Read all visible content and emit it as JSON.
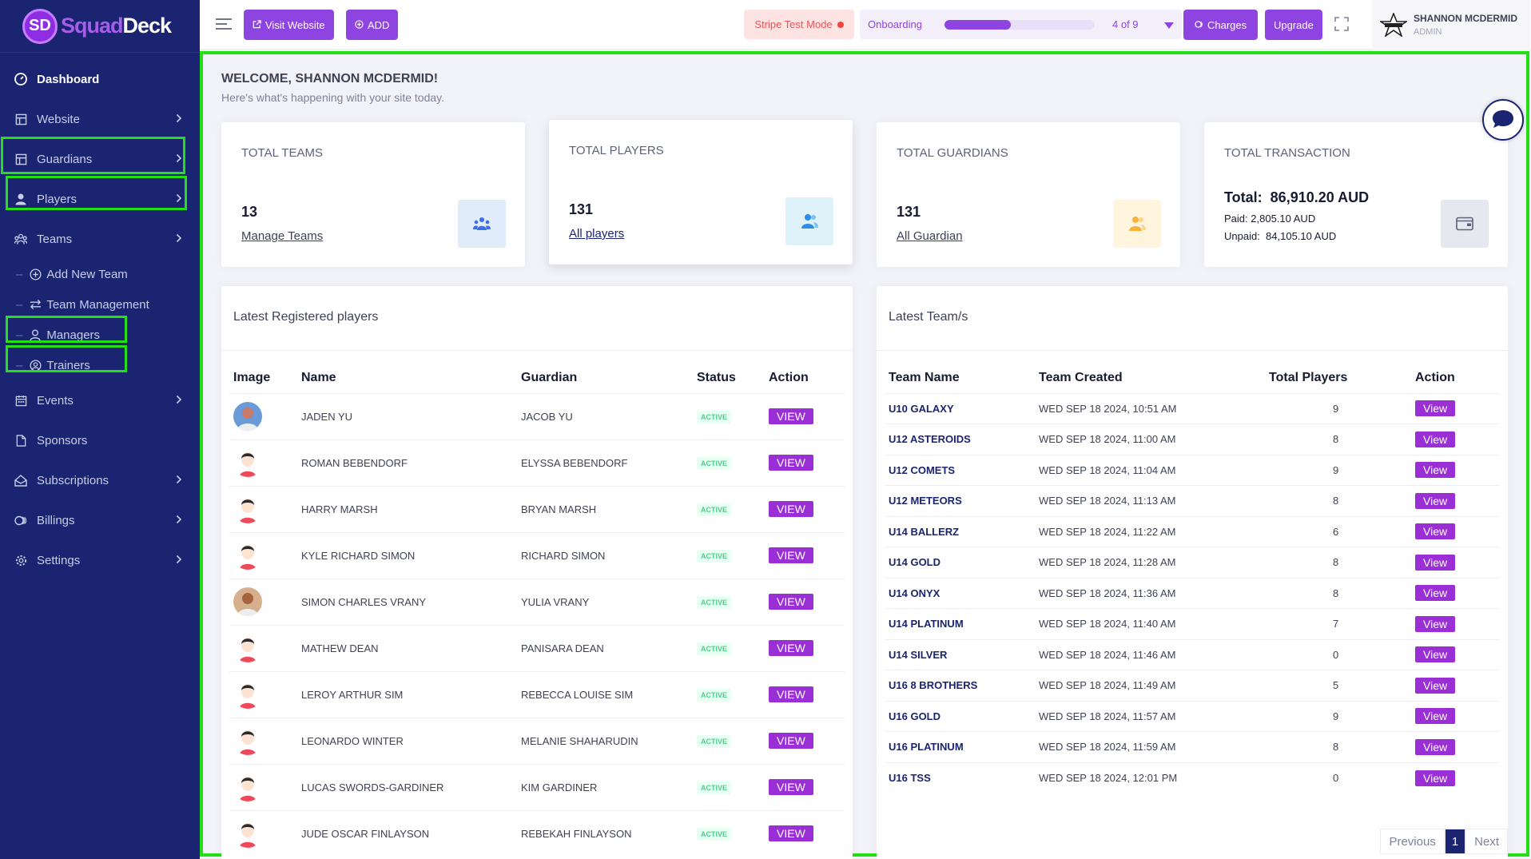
{
  "brand": {
    "logo_letters": "SD",
    "name_a": "Squad",
    "name_b": "Deck"
  },
  "sidebar": {
    "dashboard": "Dashboard",
    "website": "Website",
    "guardians": "Guardians",
    "players": "Players",
    "teams": "Teams",
    "add_new_team": "Add New Team",
    "team_management": "Team Management",
    "managers": "Managers",
    "trainers": "Trainers",
    "events": "Events",
    "sponsors": "Sponsors",
    "subscriptions": "Subscriptions",
    "billings": "Billings",
    "settings": "Settings"
  },
  "topbar": {
    "visit_website": "Visit Website",
    "add": "ADD",
    "stripe_mode": "Stripe Test Mode",
    "onboarding_label": "Onboarding",
    "onboarding_count": "4 of 9",
    "onboarding_progress": 0.44,
    "charges": "Charges",
    "upgrade": "Upgrade",
    "user_name": "SHANNON MCDERMID",
    "user_role": "ADMIN"
  },
  "welcome": {
    "title": "WELCOME, SHANNON MCDERMID!",
    "subtitle": "Here's what's happening with your site today."
  },
  "stats": {
    "teams": {
      "title": "TOTAL TEAMS",
      "value": "13",
      "link": "Manage Teams"
    },
    "players": {
      "title": "TOTAL PLAYERS",
      "value": "131",
      "link": "All players"
    },
    "guardians": {
      "title": "TOTAL GUARDIANS",
      "value": "131",
      "link": "All Guardian"
    },
    "transaction": {
      "title": "TOTAL TRANSACTION",
      "total_label": "Total:",
      "total": "86,910.20 AUD",
      "paid_label": "Paid:",
      "paid": "2,805.10 AUD",
      "unpaid_label": "Unpaid:",
      "unpaid": "84,105.10 AUD"
    }
  },
  "players_panel": {
    "title": "Latest Registered players",
    "headers": {
      "image": "Image",
      "name": "Name",
      "guardian": "Guardian",
      "status": "Status",
      "action": "Action"
    },
    "rows": [
      {
        "name": "JADEN YU",
        "guardian": "JACOB YU",
        "status": "ACTIVE",
        "action": "View"
      },
      {
        "name": "ROMAN BEBENDORF",
        "guardian": "ELYSSA BEBENDORF",
        "status": "ACTIVE",
        "action": "View"
      },
      {
        "name": "HARRY MARSH",
        "guardian": "BRYAN MARSH",
        "status": "ACTIVE",
        "action": "View"
      },
      {
        "name": "KYLE RICHARD SIMON",
        "guardian": "RICHARD SIMON",
        "status": "ACTIVE",
        "action": "View"
      },
      {
        "name": "SIMON CHARLES VRANY",
        "guardian": "YULIA VRANY",
        "status": "ACTIVE",
        "action": "View"
      },
      {
        "name": "MATHEW DEAN",
        "guardian": "PANISARA DEAN",
        "status": "ACTIVE",
        "action": "View"
      },
      {
        "name": "LEROY ARTHUR SIM",
        "guardian": "REBECCA LOUISE SIM",
        "status": "ACTIVE",
        "action": "View"
      },
      {
        "name": "LEONARDO WINTER",
        "guardian": "MELANIE SHAHARUDIN",
        "status": "ACTIVE",
        "action": "View"
      },
      {
        "name": "LUCAS SWORDS-GARDINER",
        "guardian": "KIM GARDINER",
        "status": "ACTIVE",
        "action": "View"
      },
      {
        "name": "JUDE OSCAR FINLAYSON",
        "guardian": "REBEKAH FINLAYSON",
        "status": "ACTIVE",
        "action": "View"
      }
    ]
  },
  "teams_panel": {
    "title": "Latest Team/s",
    "headers": {
      "name": "Team Name",
      "created": "Team Created",
      "players": "Total Players",
      "action": "Action"
    },
    "rows": [
      {
        "name": "U10 GALAXY",
        "created": "WED SEP 18 2024, 10:51 AM",
        "players": "9",
        "action": "View"
      },
      {
        "name": "U12 ASTEROIDS",
        "created": "WED SEP 18 2024, 11:00 AM",
        "players": "8",
        "action": "View"
      },
      {
        "name": "U12 COMETS",
        "created": "WED SEP 18 2024, 11:04 AM",
        "players": "9",
        "action": "View"
      },
      {
        "name": "U12 METEORS",
        "created": "WED SEP 18 2024, 11:13 AM",
        "players": "8",
        "action": "View"
      },
      {
        "name": "U14 BALLERZ",
        "created": "WED SEP 18 2024, 11:22 AM",
        "players": "6",
        "action": "View"
      },
      {
        "name": "U14 GOLD",
        "created": "WED SEP 18 2024, 11:28 AM",
        "players": "8",
        "action": "View"
      },
      {
        "name": "U14 ONYX",
        "created": "WED SEP 18 2024, 11:36 AM",
        "players": "8",
        "action": "View"
      },
      {
        "name": "U14 PLATINUM",
        "created": "WED SEP 18 2024, 11:40 AM",
        "players": "7",
        "action": "View"
      },
      {
        "name": "U14 SILVER",
        "created": "WED SEP 18 2024, 11:46 AM",
        "players": "0",
        "action": "View"
      },
      {
        "name": "U16 8 BROTHERS",
        "created": "WED SEP 18 2024, 11:49 AM",
        "players": "5",
        "action": "View"
      },
      {
        "name": "U16 GOLD",
        "created": "WED SEP 18 2024, 11:57 AM",
        "players": "9",
        "action": "View"
      },
      {
        "name": "U16 PLATINUM",
        "created": "WED SEP 18 2024, 11:59 AM",
        "players": "8",
        "action": "View"
      },
      {
        "name": "U16 TSS",
        "created": "WED SEP 18 2024, 12:01 PM",
        "players": "0",
        "action": "View"
      }
    ],
    "pager": {
      "prev": "Previous",
      "page": "1",
      "next": "Next"
    }
  }
}
